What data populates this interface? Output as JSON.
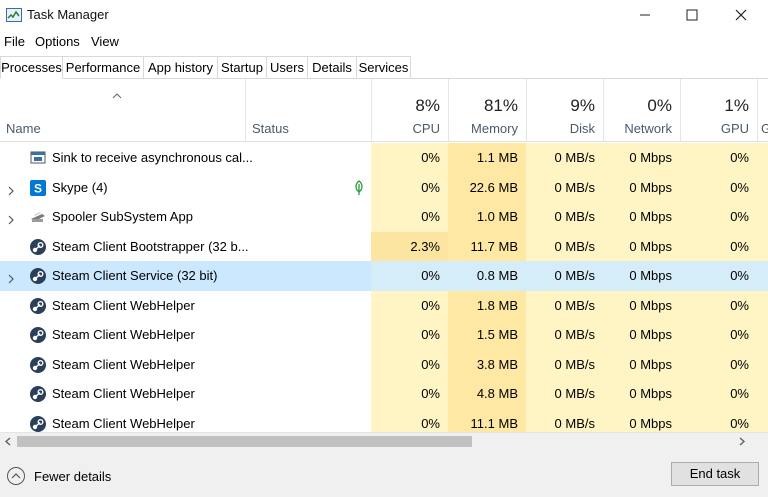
{
  "window": {
    "title": "Task Manager"
  },
  "menu": {
    "file": "File",
    "options": "Options",
    "view": "View"
  },
  "tabs": [
    {
      "label": "Processes",
      "active": true
    },
    {
      "label": "Performance"
    },
    {
      "label": "App history"
    },
    {
      "label": "Startup"
    },
    {
      "label": "Users"
    },
    {
      "label": "Details"
    },
    {
      "label": "Services"
    }
  ],
  "columns": {
    "name": "Name",
    "status": "Status",
    "cpu": {
      "pct": "8%",
      "label": "CPU"
    },
    "memory": {
      "pct": "81%",
      "label": "Memory"
    },
    "disk": {
      "pct": "9%",
      "label": "Disk"
    },
    "network": {
      "pct": "0%",
      "label": "Network"
    },
    "gpu": {
      "pct": "1%",
      "label": "GPU"
    },
    "gpu_engine_partial": "G"
  },
  "processes": [
    {
      "name": "Sink to receive asynchronous cal...",
      "icon": "window-app-icon",
      "expandable": false,
      "status_icon": "",
      "cpu": "0%",
      "memory": "1.1 MB",
      "disk": "0 MB/s",
      "network": "0 Mbps",
      "gpu": "0%"
    },
    {
      "name": "Skype (4)",
      "icon": "skype-icon",
      "expandable": true,
      "status_icon": "leaf-icon",
      "cpu": "0%",
      "memory": "22.6 MB",
      "disk": "0 MB/s",
      "network": "0 Mbps",
      "gpu": "0%"
    },
    {
      "name": "Spooler SubSystem App",
      "icon": "printer-icon",
      "expandable": true,
      "status_icon": "",
      "cpu": "0%",
      "memory": "1.0 MB",
      "disk": "0 MB/s",
      "network": "0 Mbps",
      "gpu": "0%"
    },
    {
      "name": "Steam Client Bootstrapper (32 b...",
      "icon": "steam-icon",
      "expandable": false,
      "status_icon": "",
      "cpu": "2.3%",
      "memory": "11.7 MB",
      "disk": "0 MB/s",
      "network": "0 Mbps",
      "gpu": "0%"
    },
    {
      "name": "Steam Client Service (32 bit)",
      "icon": "steam-icon",
      "expandable": true,
      "selected": true,
      "status_icon": "",
      "cpu": "0%",
      "memory": "0.8 MB",
      "disk": "0 MB/s",
      "network": "0 Mbps",
      "gpu": "0%"
    },
    {
      "name": "Steam Client WebHelper",
      "icon": "steam-icon",
      "expandable": false,
      "status_icon": "",
      "cpu": "0%",
      "memory": "1.8 MB",
      "disk": "0 MB/s",
      "network": "0 Mbps",
      "gpu": "0%"
    },
    {
      "name": "Steam Client WebHelper",
      "icon": "steam-icon",
      "expandable": false,
      "status_icon": "",
      "cpu": "0%",
      "memory": "1.5 MB",
      "disk": "0 MB/s",
      "network": "0 Mbps",
      "gpu": "0%"
    },
    {
      "name": "Steam Client WebHelper",
      "icon": "steam-icon",
      "expandable": false,
      "status_icon": "",
      "cpu": "0%",
      "memory": "3.8 MB",
      "disk": "0 MB/s",
      "network": "0 Mbps",
      "gpu": "0%"
    },
    {
      "name": "Steam Client WebHelper",
      "icon": "steam-icon",
      "expandable": false,
      "status_icon": "",
      "cpu": "0%",
      "memory": "4.8 MB",
      "disk": "0 MB/s",
      "network": "0 Mbps",
      "gpu": "0%"
    },
    {
      "name": "Steam Client WebHelper",
      "icon": "steam-icon",
      "expandable": false,
      "status_icon": "",
      "cpu": "0%",
      "memory": "11.1 MB",
      "disk": "0 MB/s",
      "network": "0 Mbps",
      "gpu": "0%"
    }
  ],
  "footer": {
    "fewer_details": "Fewer details",
    "end_task": "End task"
  },
  "colors": {
    "heat_light": "#fff4c4",
    "heat_medium": "#ffe8a3",
    "heat_cpu_high": "#fce5a0",
    "selected_row": "#cce8ff",
    "selected_heat": "#d5ecf9",
    "steam_blue": "#2a3f5a",
    "skype_blue": "#0078d4",
    "leaf_green": "#2a9a3a"
  }
}
